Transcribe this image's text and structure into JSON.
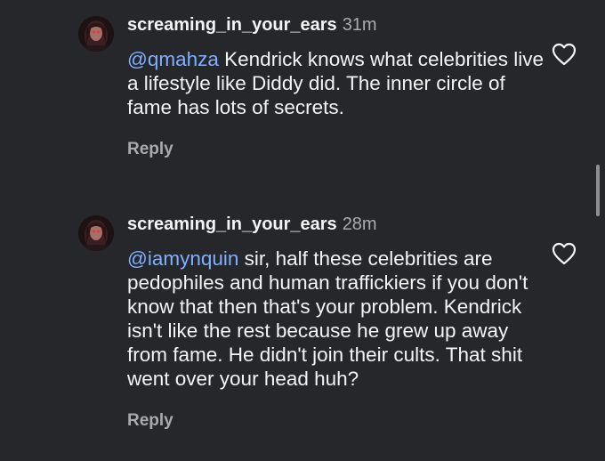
{
  "comments": [
    {
      "username": "screaming_in_your_ears",
      "time": "31m",
      "mention": "@qmahza",
      "text": " Kendrick knows what celebrities live a lifestyle like Diddy did. The inner circle of fame has lots of secrets.",
      "reply_label": "Reply",
      "like_icon": "heart-outline"
    },
    {
      "username": "screaming_in_your_ears",
      "time": "28m",
      "mention": "@iamynquin",
      "text": " sir, half these celebrities are pedophiles and human traffickiers if you don't know that then that's your problem. Kendrick isn't like the rest because he grew up away from fame. He didn't join their cults. That shit went over your head huh?",
      "reply_label": "Reply",
      "like_icon": "heart-outline"
    }
  ],
  "colors": {
    "background": "#26272b",
    "text": "#f4f4f5",
    "muted": "#a9a9ae",
    "mention": "#7fb0ff"
  }
}
